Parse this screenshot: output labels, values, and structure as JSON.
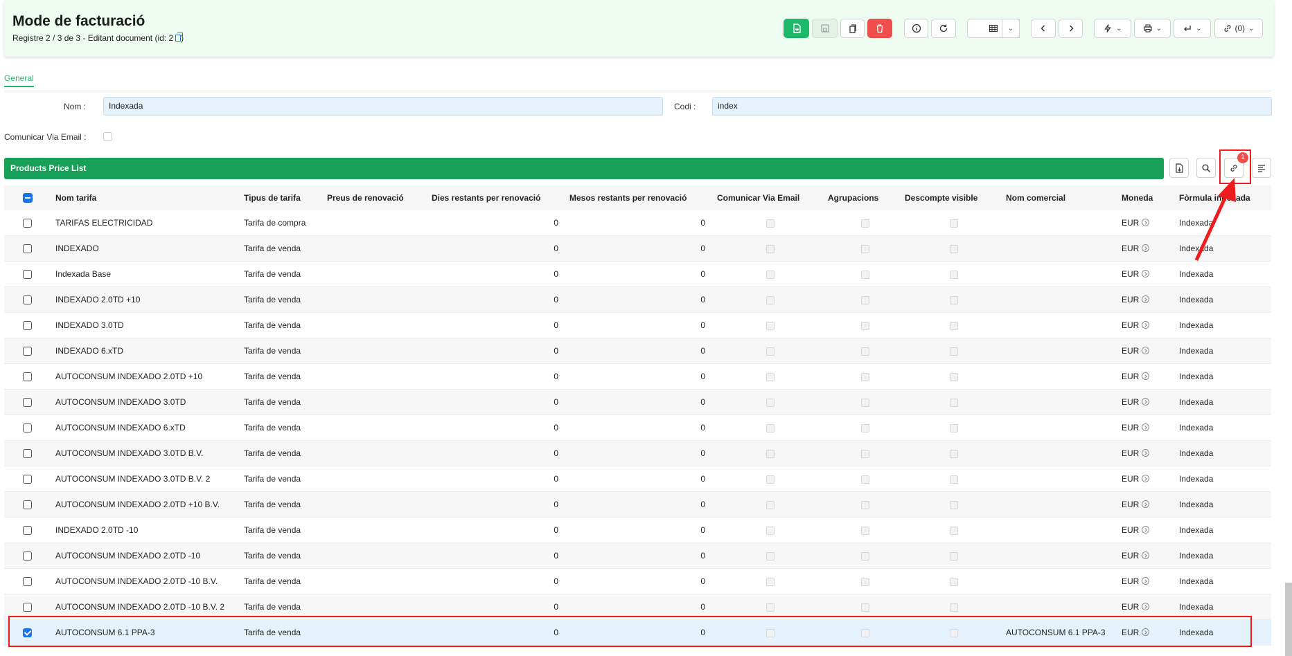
{
  "header": {
    "title": "Mode de facturació",
    "subtitle": "Registre 2 / 3 de 3 - Editant document (id: 2",
    "subtitle_close": ")",
    "toolbar": {
      "new": "new-document-icon",
      "save": "save-icon",
      "duplicate": "duplicate-icon",
      "delete": "trash-icon",
      "info": "info-icon",
      "reload": "reload-icon",
      "view": "table-view-icon",
      "prev": "chevron-left-icon",
      "next": "chevron-right-icon",
      "actions": "lightning-icon",
      "print": "printer-icon",
      "reports": "return-icon",
      "attachments_label": "(0)"
    }
  },
  "tabs": [
    {
      "label": "General"
    }
  ],
  "form": {
    "nom_label": "Nom :",
    "nom_value": "Indexada",
    "codi_label": "Codi :",
    "codi_value": "index",
    "email_label": "Comunicar Via Email :"
  },
  "grid": {
    "title": "Products Price List",
    "badge": "1",
    "columns": [
      "Nom tarifa",
      "Tipus de tarifa",
      "Preus de renovació",
      "Dies restants per renovació",
      "Mesos restants per renovació",
      "Comunicar Via Email",
      "Agrupacions",
      "Descompte visible",
      "Nom comercial",
      "Moneda",
      "Fòrmula indexada"
    ],
    "rows": [
      {
        "nom": "TARIFAS ELECTRICIDAD",
        "tipus": "Tarifa de compra",
        "dies": "0",
        "mesos": "0",
        "comercial": "",
        "moneda": "EUR",
        "formula": "Indexada",
        "selected": false
      },
      {
        "nom": "INDEXADO",
        "tipus": "Tarifa de venda",
        "dies": "0",
        "mesos": "0",
        "comercial": "",
        "moneda": "EUR",
        "formula": "Indexada",
        "selected": false
      },
      {
        "nom": "Indexada Base",
        "tipus": "Tarifa de venda",
        "dies": "0",
        "mesos": "0",
        "comercial": "",
        "moneda": "EUR",
        "formula": "Indexada",
        "selected": false
      },
      {
        "nom": "INDEXADO 2.0TD +10",
        "tipus": "Tarifa de venda",
        "dies": "0",
        "mesos": "0",
        "comercial": "",
        "moneda": "EUR",
        "formula": "Indexada",
        "selected": false
      },
      {
        "nom": "INDEXADO 3.0TD",
        "tipus": "Tarifa de venda",
        "dies": "0",
        "mesos": "0",
        "comercial": "",
        "moneda": "EUR",
        "formula": "Indexada",
        "selected": false
      },
      {
        "nom": "INDEXADO 6.xTD",
        "tipus": "Tarifa de venda",
        "dies": "0",
        "mesos": "0",
        "comercial": "",
        "moneda": "EUR",
        "formula": "Indexada",
        "selected": false
      },
      {
        "nom": "AUTOCONSUM INDEXADO 2.0TD +10",
        "tipus": "Tarifa de venda",
        "dies": "0",
        "mesos": "0",
        "comercial": "",
        "moneda": "EUR",
        "formula": "Indexada",
        "selected": false
      },
      {
        "nom": "AUTOCONSUM INDEXADO 3.0TD",
        "tipus": "Tarifa de venda",
        "dies": "0",
        "mesos": "0",
        "comercial": "",
        "moneda": "EUR",
        "formula": "Indexada",
        "selected": false
      },
      {
        "nom": "AUTOCONSUM INDEXADO 6.xTD",
        "tipus": "Tarifa de venda",
        "dies": "0",
        "mesos": "0",
        "comercial": "",
        "moneda": "EUR",
        "formula": "Indexada",
        "selected": false
      },
      {
        "nom": "AUTOCONSUM INDEXADO 3.0TD B.V.",
        "tipus": "Tarifa de venda",
        "dies": "0",
        "mesos": "0",
        "comercial": "",
        "moneda": "EUR",
        "formula": "Indexada",
        "selected": false
      },
      {
        "nom": "AUTOCONSUM INDEXADO 3.0TD B.V. 2",
        "tipus": "Tarifa de venda",
        "dies": "0",
        "mesos": "0",
        "comercial": "",
        "moneda": "EUR",
        "formula": "Indexada",
        "selected": false
      },
      {
        "nom": "AUTOCONSUM INDEXADO 2.0TD +10 B.V.",
        "tipus": "Tarifa de venda",
        "dies": "0",
        "mesos": "0",
        "comercial": "",
        "moneda": "EUR",
        "formula": "Indexada",
        "selected": false
      },
      {
        "nom": "INDEXADO 2.0TD -10",
        "tipus": "Tarifa de venda",
        "dies": "0",
        "mesos": "0",
        "comercial": "",
        "moneda": "EUR",
        "formula": "Indexada",
        "selected": false
      },
      {
        "nom": "AUTOCONSUM INDEXADO 2.0TD -10",
        "tipus": "Tarifa de venda",
        "dies": "0",
        "mesos": "0",
        "comercial": "",
        "moneda": "EUR",
        "formula": "Indexada",
        "selected": false
      },
      {
        "nom": "AUTOCONSUM INDEXADO 2.0TD -10 B.V.",
        "tipus": "Tarifa de venda",
        "dies": "0",
        "mesos": "0",
        "comercial": "",
        "moneda": "EUR",
        "formula": "Indexada",
        "selected": false
      },
      {
        "nom": "AUTOCONSUM INDEXADO 2.0TD -10 B.V. 2",
        "tipus": "Tarifa de venda",
        "dies": "0",
        "mesos": "0",
        "comercial": "",
        "moneda": "EUR",
        "formula": "Indexada",
        "selected": false
      },
      {
        "nom": "AUTOCONSUM 6.1 PPA-3",
        "tipus": "Tarifa de venda",
        "dies": "0",
        "mesos": "0",
        "comercial": "AUTOCONSUM 6.1 PPA-3",
        "moneda": "EUR",
        "formula": "Indexada",
        "selected": true
      }
    ]
  },
  "colors": {
    "accent_green": "#18a058",
    "header_bg": "#eefbf1",
    "danger_red": "#f04d4d",
    "annotation_red": "#ee1c1c",
    "link_blue": "#1a73e8"
  }
}
